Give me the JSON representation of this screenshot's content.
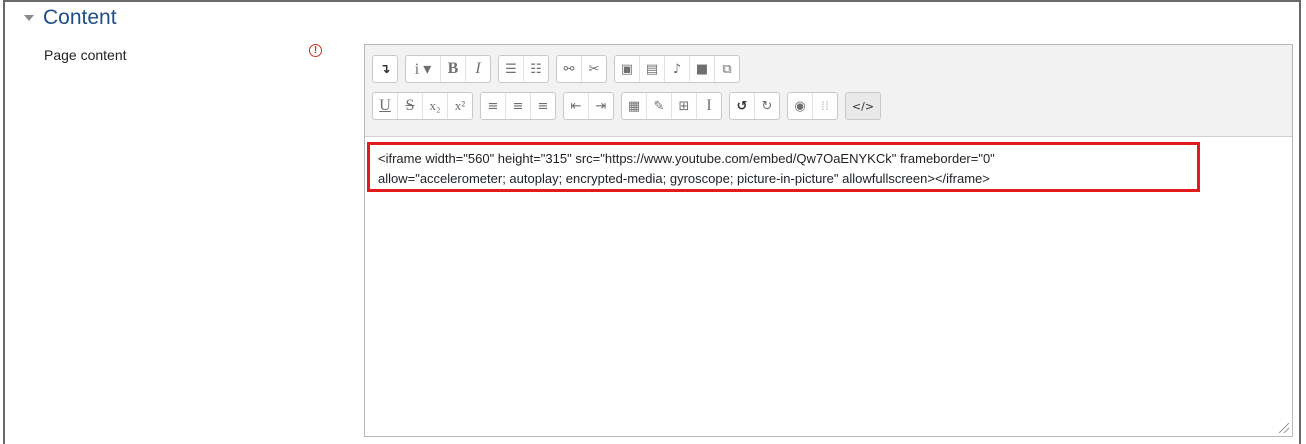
{
  "section": {
    "title": "Content"
  },
  "field": {
    "label": "Page content",
    "required_icon": "exclamation-circle-icon"
  },
  "toolbar": {
    "row1": [
      {
        "name": "toolbar-toggle-icon",
        "glyph": "↴"
      },
      {
        "name": "paragraph-style-icon",
        "glyph": "i ▾"
      },
      {
        "name": "bold-icon",
        "glyph": "B"
      },
      {
        "name": "italic-icon",
        "glyph": "I"
      },
      {
        "name": "unordered-list-icon",
        "glyph": "☰"
      },
      {
        "name": "ordered-list-icon",
        "glyph": "☷"
      },
      {
        "name": "link-icon",
        "glyph": "⚯"
      },
      {
        "name": "unlink-icon",
        "glyph": "✂"
      },
      {
        "name": "image-icon",
        "glyph": "▣"
      },
      {
        "name": "media-icon",
        "glyph": "▤"
      },
      {
        "name": "record-audio-icon",
        "glyph": "♪"
      },
      {
        "name": "record-video-icon",
        "glyph": "■"
      },
      {
        "name": "manage-files-icon",
        "glyph": "⧉"
      }
    ],
    "row2": [
      {
        "name": "underline-icon",
        "glyph": "U"
      },
      {
        "name": "strikethrough-icon",
        "glyph": "S"
      },
      {
        "name": "subscript-icon",
        "glyph": "x₂"
      },
      {
        "name": "superscript-icon",
        "glyph": "x²"
      },
      {
        "name": "align-left-icon",
        "glyph": "≡"
      },
      {
        "name": "align-center-icon",
        "glyph": "≡"
      },
      {
        "name": "align-right-icon",
        "glyph": "≡"
      },
      {
        "name": "outdent-icon",
        "glyph": "⇤"
      },
      {
        "name": "indent-icon",
        "glyph": "⇥"
      },
      {
        "name": "equation-icon",
        "glyph": "▦"
      },
      {
        "name": "special-character-icon",
        "glyph": "✎"
      },
      {
        "name": "table-icon",
        "glyph": "⊞"
      },
      {
        "name": "clear-formatting-icon",
        "glyph": "I"
      },
      {
        "name": "undo-icon",
        "glyph": "↺"
      },
      {
        "name": "redo-icon",
        "glyph": "↻"
      },
      {
        "name": "accessibility-checker-icon",
        "glyph": "◉"
      },
      {
        "name": "screenreader-helper-icon",
        "glyph": "⁞⁞"
      },
      {
        "name": "html-source-icon",
        "glyph": "</>"
      }
    ]
  },
  "editor": {
    "line1": "<iframe width=\"560\" height=\"315\" src=\"https://www.youtube.com/embed/Qw7OaENYKCk\" frameborder=\"0\"",
    "line2": "allow=\"accelerometer; autoplay; encrypted-media; gyroscope; picture-in-picture\" allowfullscreen></iframe>"
  },
  "colors": {
    "highlight_border": "#e21b1b",
    "section_title": "#1f4d8c",
    "required": "#ca3120"
  }
}
